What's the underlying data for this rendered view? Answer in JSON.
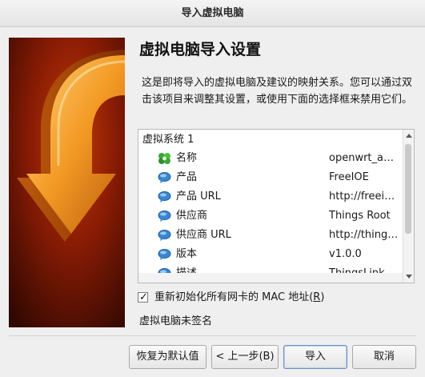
{
  "window": {
    "title": "导入虚拟电脑"
  },
  "page": {
    "heading": "虚拟电脑导入设置",
    "description": "这是即将导入的虚拟电脑及建议的映射关系。您可以通过双击该项目来调整其设置，或使用下面的选择框来禁用它们。"
  },
  "tree": {
    "root": "虚拟系统 1",
    "rows": [
      {
        "label": "名称",
        "value": "openwrt_a…",
        "icon": "name-icon"
      },
      {
        "label": "产品",
        "value": "FreeIOE",
        "icon": "speech-bubble-icon"
      },
      {
        "label": "产品 URL",
        "value": "http://freei…",
        "icon": "speech-bubble-icon"
      },
      {
        "label": "供应商",
        "value": "Things Root",
        "icon": "speech-bubble-icon"
      },
      {
        "label": "供应商 URL",
        "value": "http://thing…",
        "icon": "speech-bubble-icon"
      },
      {
        "label": "版本",
        "value": "v1.0.0",
        "icon": "speech-bubble-icon"
      },
      {
        "label": "描述",
        "value": "ThingsLink…",
        "icon": "speech-bubble-icon"
      }
    ]
  },
  "options": {
    "reinit_mac_label": "重新初始化所有网卡的 MAC 地址(",
    "reinit_mac_hotkey": "R",
    "reinit_mac_suffix": ")",
    "reinit_mac_checked": true,
    "signature_status": "虚拟电脑未签名"
  },
  "buttons": {
    "restore_defaults": "恢复为默认值",
    "back": "< 上一步(B)",
    "import": "导入",
    "cancel": "取消"
  },
  "colors": {
    "banner_dark": "#3a0a02",
    "banner_orange": "#e8821a",
    "list_icon_blue": "#3a86d0",
    "name_icon_green": "#3aa53a"
  }
}
